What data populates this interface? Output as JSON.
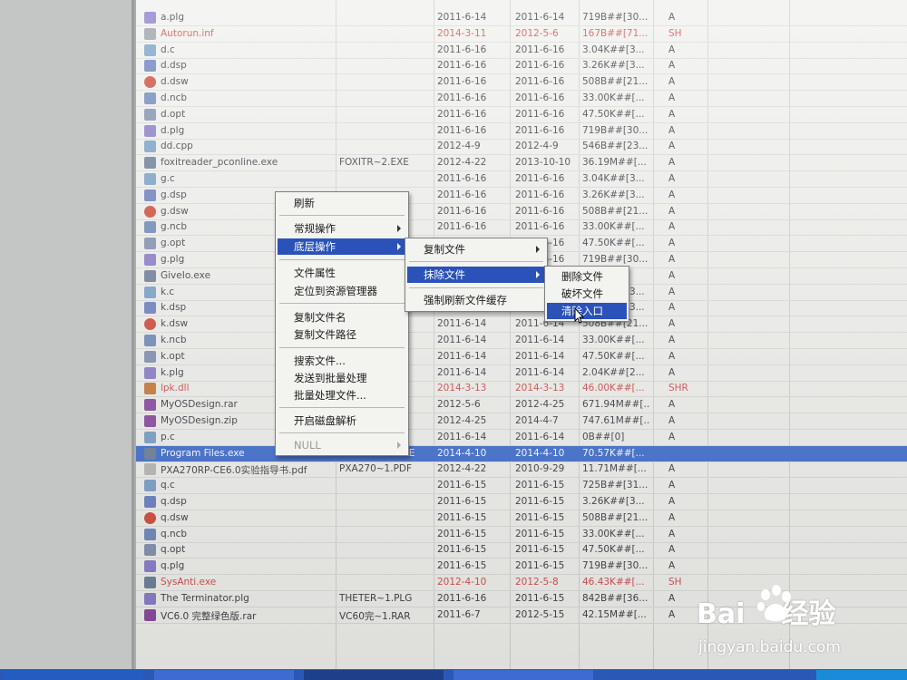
{
  "colors": {
    "selection": "#3f6fcf",
    "menu_highlight": "#2b52b8",
    "hidden_red": "#d24d4d",
    "taskbar": "#2a58b6"
  },
  "files": [
    {
      "name": "a.plg",
      "short": "",
      "created": "2011-6-14",
      "modified": "2011-6-14",
      "size": "719B##[30...",
      "attr": "A",
      "red": false,
      "icon": "plg-file-icon"
    },
    {
      "name": "Autorun.inf",
      "short": "",
      "created": "2014-3-11",
      "modified": "2012-5-6",
      "size": "167B##[71...",
      "attr": "SH",
      "red": true,
      "icon": "inf-file-icon"
    },
    {
      "name": "d.c",
      "short": "",
      "created": "2011-6-16",
      "modified": "2011-6-16",
      "size": "3.04K##[3...",
      "attr": "A",
      "red": false,
      "icon": "c-file-icon"
    },
    {
      "name": "d.dsp",
      "short": "",
      "created": "2011-6-16",
      "modified": "2011-6-16",
      "size": "3.26K##[3...",
      "attr": "A",
      "red": false,
      "icon": "dsp-file-icon"
    },
    {
      "name": "d.dsw",
      "short": "",
      "created": "2011-6-16",
      "modified": "2011-6-16",
      "size": "508B##[21...",
      "attr": "A",
      "red": false,
      "icon": "dsw-file-icon"
    },
    {
      "name": "d.ncb",
      "short": "",
      "created": "2011-6-16",
      "modified": "2011-6-16",
      "size": "33.00K##[...",
      "attr": "A",
      "red": false,
      "icon": "ncb-file-icon"
    },
    {
      "name": "d.opt",
      "short": "",
      "created": "2011-6-16",
      "modified": "2011-6-16",
      "size": "47.50K##[...",
      "attr": "A",
      "red": false,
      "icon": "opt-file-icon"
    },
    {
      "name": "d.plg",
      "short": "",
      "created": "2011-6-16",
      "modified": "2011-6-16",
      "size": "719B##[30...",
      "attr": "A",
      "red": false,
      "icon": "plg-file-icon"
    },
    {
      "name": "dd.cpp",
      "short": "",
      "created": "2012-4-9",
      "modified": "2012-4-9",
      "size": "546B##[23...",
      "attr": "A",
      "red": false,
      "icon": "cpp-file-icon"
    },
    {
      "name": "foxitreader_pconline.exe",
      "short": "FOXITR~2.EXE",
      "created": "2012-4-22",
      "modified": "2013-10-10",
      "size": "36.19M##[...",
      "attr": "A",
      "red": false,
      "icon": "exe-file-icon"
    },
    {
      "name": "g.c",
      "short": "",
      "created": "2011-6-16",
      "modified": "2011-6-16",
      "size": "3.04K##[3...",
      "attr": "A",
      "red": false,
      "icon": "c-file-icon"
    },
    {
      "name": "g.dsp",
      "short": "",
      "created": "2011-6-16",
      "modified": "2011-6-16",
      "size": "3.26K##[3...",
      "attr": "A",
      "red": false,
      "icon": "dsp-file-icon"
    },
    {
      "name": "g.dsw",
      "short": "",
      "created": "2011-6-16",
      "modified": "2011-6-16",
      "size": "508B##[21...",
      "attr": "A",
      "red": false,
      "icon": "dsw-file-icon"
    },
    {
      "name": "g.ncb",
      "short": "",
      "created": "2011-6-16",
      "modified": "2011-6-16",
      "size": "33.00K##[...",
      "attr": "A",
      "red": false,
      "icon": "ncb-file-icon"
    },
    {
      "name": "g.opt",
      "short": "",
      "created": "2011-6-16",
      "modified": "2011-6-16",
      "size": "47.50K##[...",
      "attr": "A",
      "red": false,
      "icon": "opt-file-icon"
    },
    {
      "name": "g.plg",
      "short": "",
      "created": "2011-6-16",
      "modified": "2011-6-16",
      "size": "719B##[30...",
      "attr": "A",
      "red": false,
      "icon": "plg-file-icon"
    },
    {
      "name": "GiveIo.exe",
      "short": "",
      "created": "",
      "modified": "",
      "size": "",
      "attr": "A",
      "red": false,
      "icon": "exe-file-icon"
    },
    {
      "name": "k.c",
      "short": "",
      "created": "",
      "modified": "",
      "size": "3.04K##[3...",
      "attr": "A",
      "red": false,
      "icon": "c-file-icon"
    },
    {
      "name": "k.dsp",
      "short": "",
      "created": "2011-6-14",
      "modified": "2011-6-14",
      "size": "3.26K##[3...",
      "attr": "A",
      "red": false,
      "icon": "dsp-file-icon"
    },
    {
      "name": "k.dsw",
      "short": "",
      "created": "2011-6-14",
      "modified": "2011-6-14",
      "size": "508B##[21...",
      "attr": "A",
      "red": false,
      "icon": "dsw-file-icon"
    },
    {
      "name": "k.ncb",
      "short": "",
      "created": "2011-6-14",
      "modified": "2011-6-14",
      "size": "33.00K##[...",
      "attr": "A",
      "red": false,
      "icon": "ncb-file-icon"
    },
    {
      "name": "k.opt",
      "short": "",
      "created": "2011-6-14",
      "modified": "2011-6-14",
      "size": "47.50K##[...",
      "attr": "A",
      "red": false,
      "icon": "opt-file-icon"
    },
    {
      "name": "k.plg",
      "short": "",
      "created": "2011-6-14",
      "modified": "2011-6-14",
      "size": "2.04K##[2...",
      "attr": "A",
      "red": false,
      "icon": "plg-file-icon"
    },
    {
      "name": "lpk.dll",
      "short": "",
      "created": "2014-3-13",
      "modified": "2014-3-13",
      "size": "46.00K##[...",
      "attr": "SHR",
      "red": true,
      "icon": "dll-file-icon"
    },
    {
      "name": "MyOSDesign.rar",
      "short": "",
      "created": "2012-5-6",
      "modified": "2012-4-25",
      "size": "671.94M##[...",
      "attr": "A",
      "red": false,
      "icon": "rar-file-icon"
    },
    {
      "name": "MyOSDesign.zip",
      "short": "",
      "created": "2012-4-25",
      "modified": "2014-4-7",
      "size": "747.61M##[...",
      "attr": "A",
      "red": false,
      "icon": "zip-file-icon"
    },
    {
      "name": "p.c",
      "short": "",
      "created": "2011-6-14",
      "modified": "2011-6-14",
      "size": "0B##[0]",
      "attr": "A",
      "red": false,
      "icon": "c-file-icon"
    },
    {
      "name": "Program Files.exe",
      "short": "PROGRA~1.EXE",
      "created": "2014-4-10",
      "modified": "2014-4-10",
      "size": "70.57K##[...",
      "attr": "",
      "red": false,
      "icon": "exe-file-icon",
      "selected": true
    },
    {
      "name": "PXA270RP-CE6.0实验指导书.pdf",
      "short": "PXA270~1.PDF",
      "created": "2012-4-22",
      "modified": "2010-9-29",
      "size": "11.71M##[...",
      "attr": "A",
      "red": false,
      "icon": "pdf-file-icon"
    },
    {
      "name": "q.c",
      "short": "",
      "created": "2011-6-15",
      "modified": "2011-6-15",
      "size": "725B##[31...",
      "attr": "A",
      "red": false,
      "icon": "c-file-icon"
    },
    {
      "name": "q.dsp",
      "short": "",
      "created": "2011-6-15",
      "modified": "2011-6-15",
      "size": "3.26K##[3...",
      "attr": "A",
      "red": false,
      "icon": "dsp-file-icon"
    },
    {
      "name": "q.dsw",
      "short": "",
      "created": "2011-6-15",
      "modified": "2011-6-15",
      "size": "508B##[21...",
      "attr": "A",
      "red": false,
      "icon": "dsw-file-icon"
    },
    {
      "name": "q.ncb",
      "short": "",
      "created": "2011-6-15",
      "modified": "2011-6-15",
      "size": "33.00K##[...",
      "attr": "A",
      "red": false,
      "icon": "ncb-file-icon"
    },
    {
      "name": "q.opt",
      "short": "",
      "created": "2011-6-15",
      "modified": "2011-6-15",
      "size": "47.50K##[...",
      "attr": "A",
      "red": false,
      "icon": "opt-file-icon"
    },
    {
      "name": "q.plg",
      "short": "",
      "created": "2011-6-15",
      "modified": "2011-6-15",
      "size": "719B##[30...",
      "attr": "A",
      "red": false,
      "icon": "plg-file-icon"
    },
    {
      "name": "SysAnti.exe",
      "short": "",
      "created": "2012-4-10",
      "modified": "2012-5-8",
      "size": "46.43K##[...",
      "attr": "SH",
      "red": true,
      "icon": "exe-file-icon"
    },
    {
      "name": "The Terminator.plg",
      "short": "THETER~1.PLG",
      "created": "2011-6-16",
      "modified": "2011-6-15",
      "size": "842B##[36...",
      "attr": "A",
      "red": false,
      "icon": "plg-file-icon"
    },
    {
      "name": "VC6.0 完整绿色版.rar",
      "short": "VC60完~1.RAR",
      "created": "2011-6-7",
      "modified": "2012-5-15",
      "size": "42.15M##[...",
      "attr": "A",
      "red": false,
      "icon": "rar-file-icon"
    }
  ],
  "menu1": {
    "refresh": "刷新",
    "normal_ops": "常规操作",
    "low_level_ops": "底层操作",
    "file_props": "文件属性",
    "locate_explorer": "定位到资源管理器",
    "copy_name": "复制文件名",
    "copy_path": "复制文件路径",
    "search_file": "搜索文件...",
    "send_batch": "发送到批量处理",
    "batch_files": "批量处理文件...",
    "disk_parse": "开启磁盘解析",
    "null_item": "NULL"
  },
  "menu2": {
    "copy_file": "复制文件",
    "erase_file": "抹除文件",
    "force_flush": "强制刷新文件缓存"
  },
  "menu3": {
    "delete_file": "删除文件",
    "corrupt_file": "破坏文件",
    "clear_entry": "清除入口"
  },
  "watermark": {
    "brand": "Bai",
    "brand2": "经验",
    "url": "jingyan.baidu.com"
  }
}
